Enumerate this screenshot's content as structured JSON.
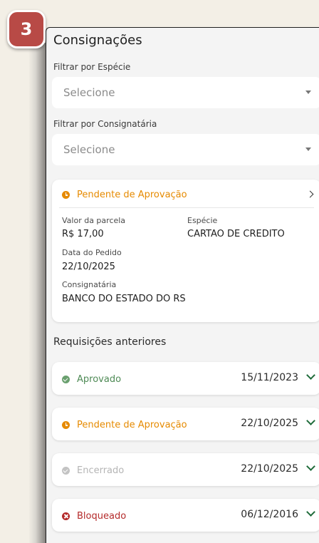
{
  "step_badge": "3",
  "page": {
    "title": "Consignações"
  },
  "filters": {
    "especie": {
      "label": "Filtrar por Espécie",
      "placeholder": "Selecione"
    },
    "consignataria": {
      "label": "Filtrar por Consignatária",
      "placeholder": "Selecione"
    }
  },
  "current_request": {
    "status": "Pendente de Aprovação",
    "status_color": "#e68a00",
    "valor_label": "Valor da parcela",
    "valor_value": "R$ 17,00",
    "especie_label": "Espécie",
    "especie_value": "CARTAO DE CREDITO",
    "data_label": "Data do Pedido",
    "data_value": "22/10/2025",
    "consignataria_label": "Consignatária",
    "consignataria_value": "BANCO DO ESTADO DO RS"
  },
  "previous": {
    "title": "Requisições anteriores",
    "items": [
      {
        "status": "Aprovado",
        "date": "15/11/2023",
        "icon": "check-circle-icon",
        "color": "#4e8a55"
      },
      {
        "status": "Pendente de Aprovação",
        "date": "22/10/2025",
        "icon": "clock-icon",
        "color": "#e68a00"
      },
      {
        "status": "Encerrado",
        "date": "22/10/2025",
        "icon": "check-circle-icon",
        "color": "#b5b5b5"
      },
      {
        "status": "Bloqueado",
        "date": "06/12/2016",
        "icon": "x-circle-icon",
        "color": "#b42a2a"
      }
    ]
  }
}
